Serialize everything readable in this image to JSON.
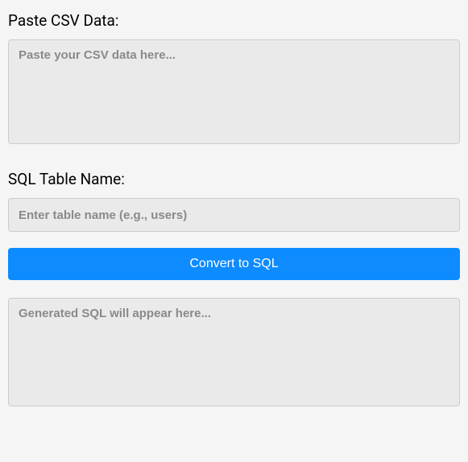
{
  "csv": {
    "label": "Paste CSV Data:",
    "placeholder": "Paste your CSV data here...",
    "value": ""
  },
  "table": {
    "label": "SQL Table Name:",
    "placeholder": "Enter table name (e.g., users)",
    "value": ""
  },
  "button": {
    "label": "Convert to SQL"
  },
  "output": {
    "placeholder": "Generated SQL will appear here...",
    "value": ""
  }
}
